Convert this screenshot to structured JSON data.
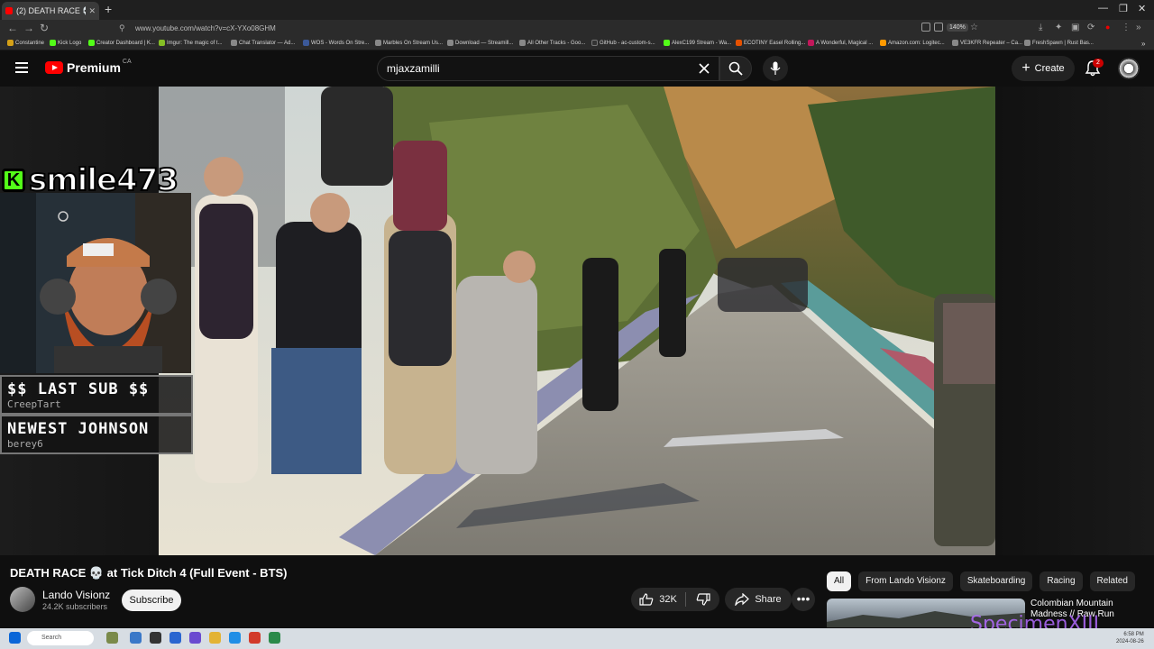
{
  "browser": {
    "tab_title": "(2) DEATH RACE 💀 at Tick Ditc",
    "url": "www.youtube.com/watch?v=cX-YXo08GHM",
    "zoom": "140%",
    "bookmarks": [
      "Constantine",
      "Kick Logo",
      "Creator Dashboard | K...",
      "Imgur: The magic of t...",
      "Chat Translator — Ad...",
      "WOS - Words On Stre...",
      "Marbles On Stream Us...",
      "Download — Streamill...",
      "All Other Tracks - Goo...",
      "GitHub - ac-custom-s...",
      "AlexC199 Stream - Wa...",
      "ECOTINY Easel Rolling...",
      "A Wonderful, Magical ...",
      "Amazon.com: Logitec...",
      "VE3KFR Repeater – Ca...",
      "FreshSpawn | Rust Bas..."
    ],
    "bookmark_colors": [
      "#d4a017",
      "#53fc18",
      "#53fc18",
      "#85bf25",
      "#888",
      "#3b5998",
      "#888",
      "#888",
      "#888",
      "#333",
      "#53fc18",
      "#e65100",
      "#c2185b",
      "#ff9900",
      "#888",
      "#888"
    ]
  },
  "youtube": {
    "logo_text": "Premium",
    "region": "CA",
    "search_value": "mjaxzamilli",
    "create_label": "Create",
    "notification_count": "2"
  },
  "stream_overlay": {
    "channel_name": "smile473",
    "last_sub_heading": "$$ LAST SUB $$",
    "last_sub_name": "CreepTart",
    "newest_heading": "NEWEST JOHNSON",
    "newest_name": "berey6",
    "corner_text": "SpecimenXIII"
  },
  "video": {
    "title": "DEATH RACE 💀 at Tick Ditch 4 (Full Event - BTS)",
    "channel": "Lando Visionz",
    "subscribers": "24.2K subscribers",
    "subscribe_label": "Subscribe",
    "likes": "32K",
    "share_label": "Share",
    "more_label": "•••"
  },
  "chips": [
    "All",
    "From Lando Visionz",
    "Skateboarding",
    "Racing",
    "Related"
  ],
  "related": {
    "title": "Colombian Mountain Madness // Raw Run"
  },
  "taskbar": {
    "search_placeholder": "Search",
    "lang": "ENG\nUS",
    "time": "6:58 PM",
    "date": "2024-08-26"
  }
}
